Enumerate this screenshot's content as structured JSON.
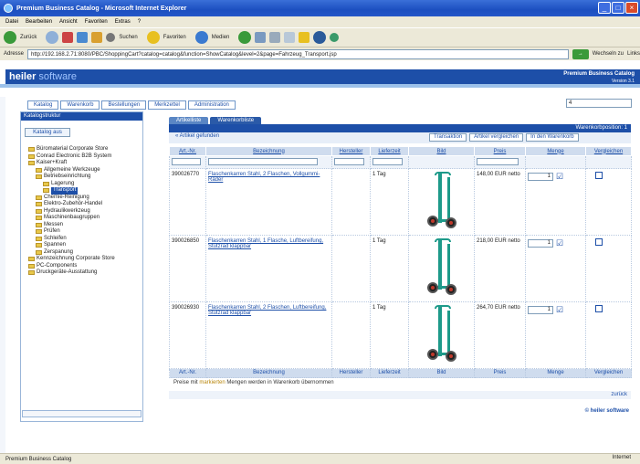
{
  "window": {
    "title": "Premium Business Catalog - Microsoft Internet Explorer",
    "menu": [
      "Datei",
      "Bearbeiten",
      "Ansicht",
      "Favoriten",
      "Extras",
      "?"
    ],
    "toolbar": {
      "back": "Zurück",
      "search": "Suchen",
      "favorites": "Favoriten",
      "media": "Medien"
    },
    "address_label": "Adresse",
    "address": "http://192.168.2.71:8080/PBC/ShoppingCart?catalog=catalog&function=ShowCatalog&level=2&page=Fahrzeug_Transport.jsp",
    "go_label": "Wechseln zu",
    "links_label": "Links",
    "status_left": "Premium Business Catalog",
    "status_right": "Internet"
  },
  "app": {
    "logo_brand": "heiler",
    "logo_product": "software",
    "title": "Premium Business Catalog",
    "version": "Version 3.1",
    "nav_tabs": [
      "Katalog",
      "Warenkorb",
      "Bestellungen",
      "Merkzettel",
      "Administration"
    ],
    "top_select_value": "4"
  },
  "sidebar": {
    "header": "Katalogstruktur",
    "button": "Katalog aus",
    "tree": [
      {
        "label": "Büromaterial Corporate Store",
        "level": 0,
        "selected": false
      },
      {
        "label": "Conrad Electronic B2B System",
        "level": 0,
        "selected": false
      },
      {
        "label": "Kaiser+Kraft",
        "level": 0,
        "selected": false
      },
      {
        "label": "Allgemeine Werkzeuge",
        "level": 1,
        "selected": false
      },
      {
        "label": "Betriebseinrichtung",
        "level": 1,
        "selected": false
      },
      {
        "label": "Lagerung",
        "level": 2,
        "selected": false
      },
      {
        "label": "Transport",
        "level": 2,
        "selected": true
      },
      {
        "label": "Chemie-Reinigung",
        "level": 1,
        "selected": false
      },
      {
        "label": "Elektro-Zubehör-Handel",
        "level": 1,
        "selected": false
      },
      {
        "label": "Hydraulikwerkzeug",
        "level": 1,
        "selected": false
      },
      {
        "label": "Maschinenbaugruppen",
        "level": 1,
        "selected": false
      },
      {
        "label": "Messen",
        "level": 1,
        "selected": false
      },
      {
        "label": "Prüfen",
        "level": 1,
        "selected": false
      },
      {
        "label": "Schleifen",
        "level": 1,
        "selected": false
      },
      {
        "label": "Spannen",
        "level": 1,
        "selected": false
      },
      {
        "label": "Zerspanung",
        "level": 1,
        "selected": false
      },
      {
        "label": "Kennzeichnung Corporate Store",
        "level": 0,
        "selected": false
      },
      {
        "label": "PC-Components",
        "level": 0,
        "selected": false
      },
      {
        "label": "Druckgeräte-Ausstattung",
        "level": 0,
        "selected": false
      }
    ]
  },
  "main": {
    "tabs": [
      "Artikelliste",
      "Warenkorbliste"
    ],
    "header_right": "Warenkorbposition: 1",
    "back_link": "« Artikel gefunden",
    "actions": [
      "Transaktion",
      "Artikel vergleichen",
      "In den Warenkorb"
    ],
    "columns": [
      "Art.-Nr.",
      "Bezeichnung",
      "Hersteller",
      "Lieferzeit",
      "Bild",
      "Preis",
      "Menge",
      "Vergleichen"
    ],
    "rows": [
      {
        "id": "390026770",
        "desc": "Flaschenkarren Stahl, 2 Flaschen, Vollgummi-Räder",
        "maker": "",
        "delivery": "1 Tag",
        "price": "148,00 EUR netto",
        "qty": "1"
      },
      {
        "id": "390026850",
        "desc": "Flaschenkarren Stahl, 1 Flasche, Luftbereifung, Stützrad klappbar",
        "maker": "",
        "delivery": "1 Tag",
        "price": "218,00 EUR netto",
        "qty": "1"
      },
      {
        "id": "390026930",
        "desc": "Flaschenkarren Stahl, 2 Flaschen, Luftbereifung, Stützrad klappbar",
        "maker": "",
        "delivery": "1 Tag",
        "price": "264,70 EUR netto",
        "qty": "1"
      }
    ],
    "note_prefix": "Preise mit ",
    "note_highlight": "markierten",
    "note_suffix": " Mengen werden in Warenkorb übernommen",
    "bottom_link": "zurück",
    "brand": "© heiler software"
  }
}
